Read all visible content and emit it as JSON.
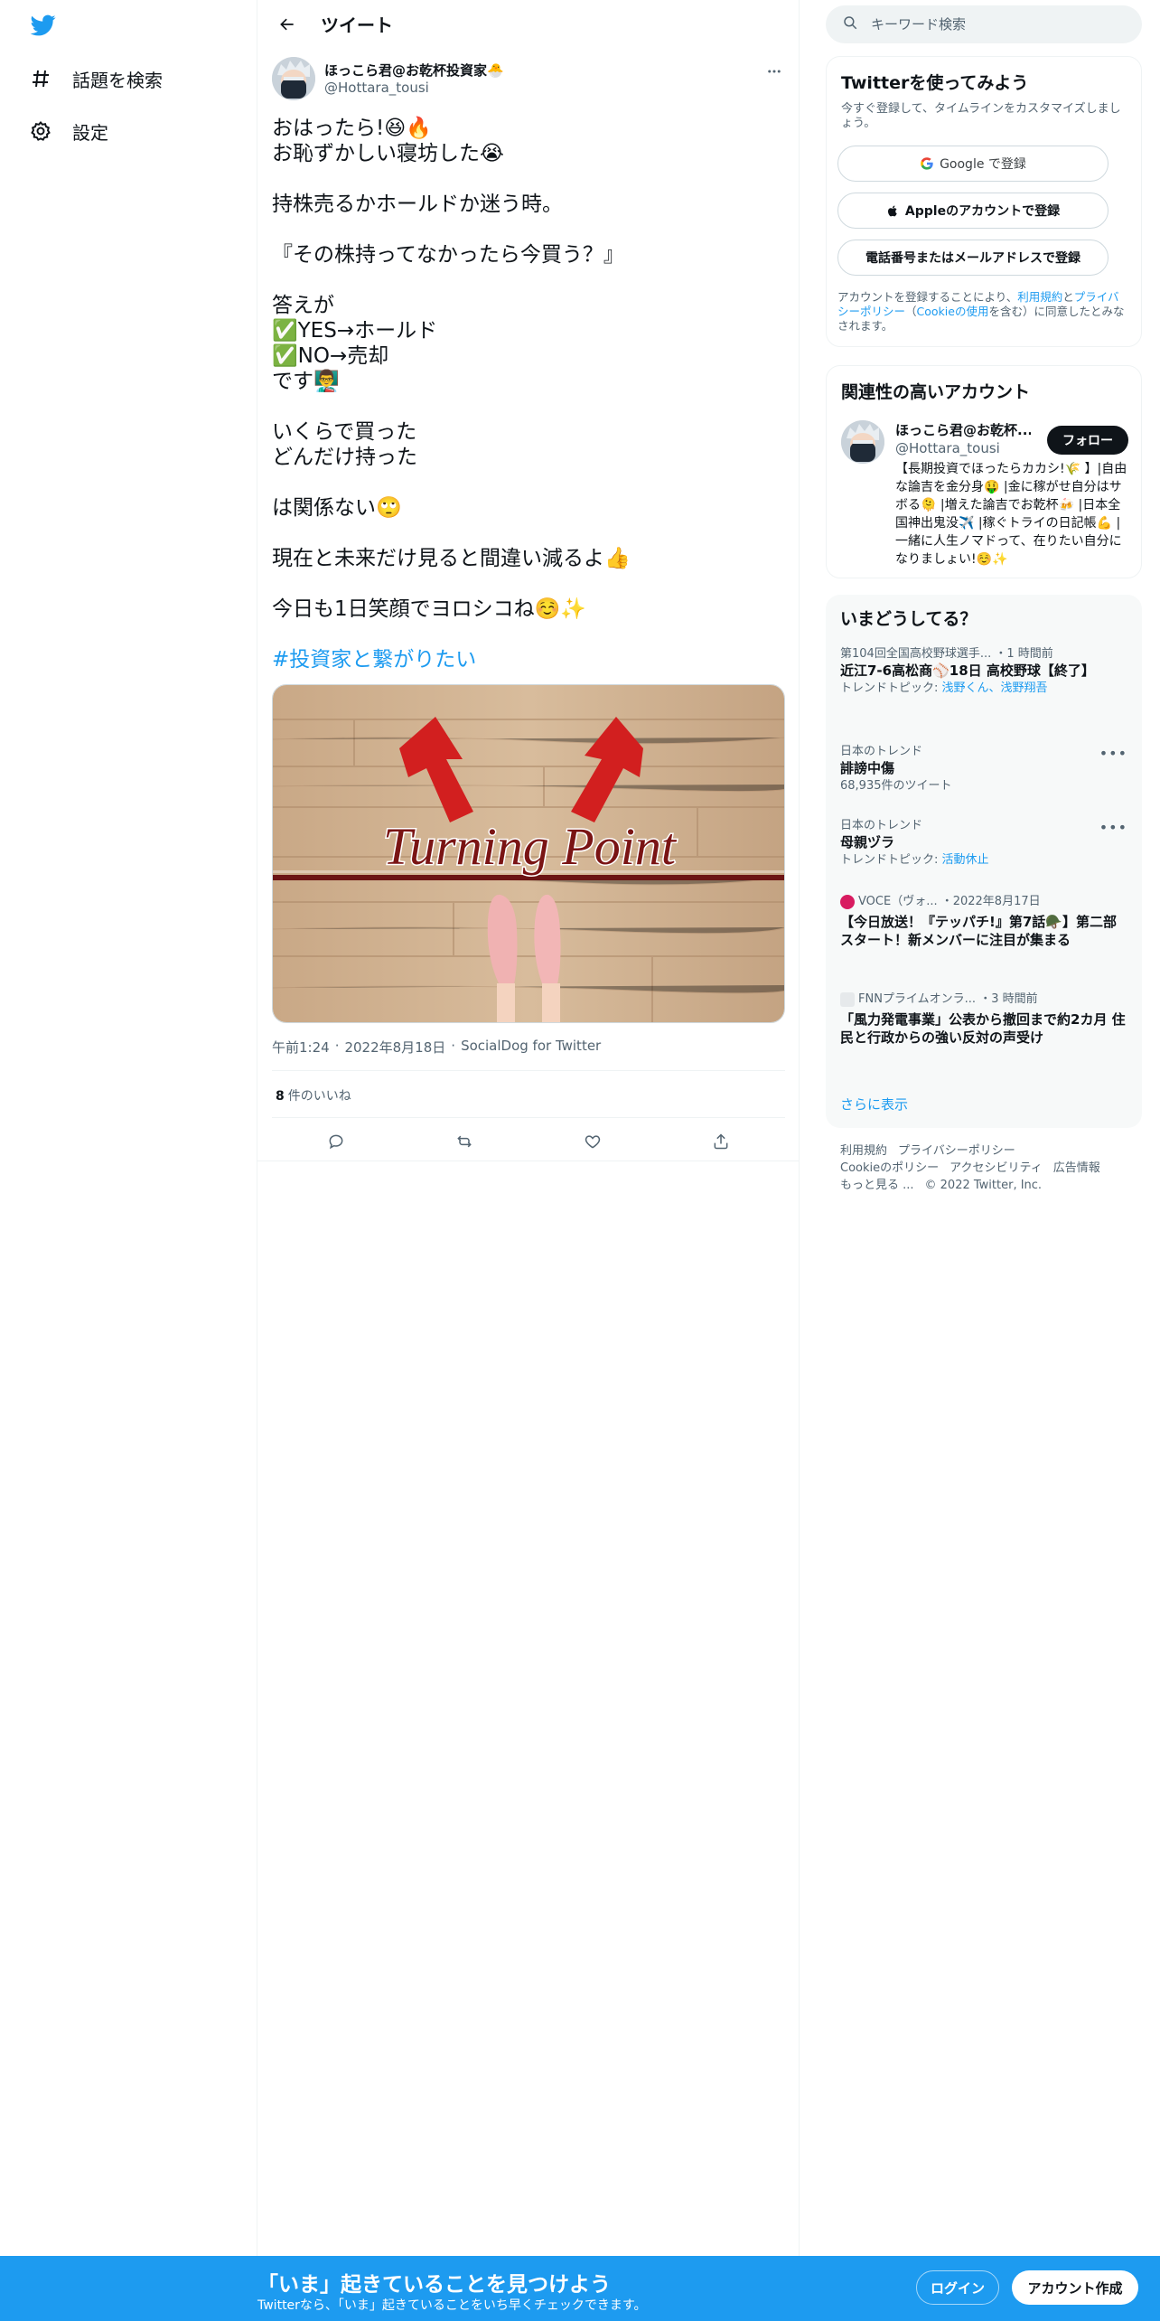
{
  "nav": {
    "explore_label": "話題を検索",
    "settings_label": "設定"
  },
  "header": {
    "title": "ツイート"
  },
  "tweet": {
    "author_name": "ほっこら君@お乾杯投資家🐣",
    "author_handle": "@Hottara_tousi",
    "lines": [
      "おはったら!😆🔥",
      "お恥ずかしい寝坊した😭",
      "",
      "持株売るかホールドか迷う時。",
      "",
      "『その株持ってなかったら今買う？』",
      "",
      "答えが",
      "✅YES→ホールド",
      "✅NO→売却",
      "です👨‍🏫",
      "",
      "いくらで買った",
      "どんだけ持った",
      "",
      "は関係ない🙄",
      "",
      "現在と未来だけ見ると間違い減るよ👍",
      "",
      "今日も1日笑顔でヨロシコね☺️✨",
      ""
    ],
    "hashtag": "#投資家と繋がりたい",
    "image_text": "Turning Point",
    "time": "午前1:24",
    "date": "2022年8月18日",
    "source": "SocialDog for Twitter",
    "likes_count": "8",
    "likes_label": "件のいいね"
  },
  "search": {
    "placeholder": "キーワード検索"
  },
  "signup": {
    "title": "Twitterを使ってみよう",
    "subtitle": "今すぐ登録して、タイムラインをカスタマイズしましょう。",
    "google_label": "Google で登録",
    "apple_label": "Appleのアカウントで登録",
    "phone_label": "電話番号またはメールアドレスで登録",
    "legal_prefix": "アカウントを登録することにより、",
    "terms": "利用規約",
    "and": "と",
    "privacy": "プライバシーポリシー",
    "cookie_open": "（",
    "cookie": "Cookieの使用",
    "legal_suffix": "を含む）に同意したとみなされます。"
  },
  "related": {
    "title": "関連性の高いアカウント",
    "name": "ほっこら君@お乾杯...",
    "handle": "@Hottara_tousi",
    "follow_label": "フォロー",
    "bio": "【長期投資でほったらカカシ!🌾 】|自由な論吉を金分身🤑 |金に稼がせ自分はサボる🫠 |増えた論吉でお乾杯🍻 |日本全国神出鬼没✈️ |稼ぐトライの日記帳💪 |一緒に人生ノマドって、在りたい自分になりましょい!☺️✨"
  },
  "trends": {
    "title": "いまどうしてる？",
    "items": [
      {
        "meta": "第104回全国高校野球選手... ・1 時間前",
        "title": "近江7-6高松商⚾18日 高校野球【終了】",
        "sub_prefix": "トレンドトピック: ",
        "sub_link": "浅野くん、浅野翔吾"
      },
      {
        "meta": "日本のトレンド",
        "title": "誹謗中傷",
        "sub_prefix": "68,935件のツイート",
        "sub_link": ""
      },
      {
        "meta": "日本のトレンド",
        "title": "母親ヅラ",
        "sub_prefix": "トレンドトピック: ",
        "sub_link": "活動休止"
      },
      {
        "meta": "VOCE（ヴォ... ・2022年8月17日",
        "title": "【今日放送！『テッパチ!』第7話🪖】第二部スタート！新メンバーに注目が集まる",
        "sub_prefix": "",
        "sub_link": ""
      },
      {
        "meta": "FNNプライムオンラ... ・3 時間前",
        "title": "「風力発電事業」公表から撤回まで約2カ月 住民と行政からの強い反対の声受け",
        "sub_prefix": "",
        "sub_link": ""
      }
    ],
    "show_more": "さらに表示"
  },
  "footer": {
    "links": [
      "利用規約",
      "プライバシーポリシー",
      "Cookieのポリシー",
      "アクセシビリティ",
      "広告情報",
      "もっと見る ...",
      "© 2022 Twitter, Inc."
    ]
  },
  "bottom": {
    "title": "「いま」起きていることを見つけよう",
    "subtitle": "Twitterなら、「いま」起きていることをいち早くチェックできます。",
    "login": "ログイン",
    "signup": "アカウント作成"
  },
  "colors": {
    "accent": "#1d9bf0",
    "text": "#0f1419",
    "muted": "#536471"
  }
}
